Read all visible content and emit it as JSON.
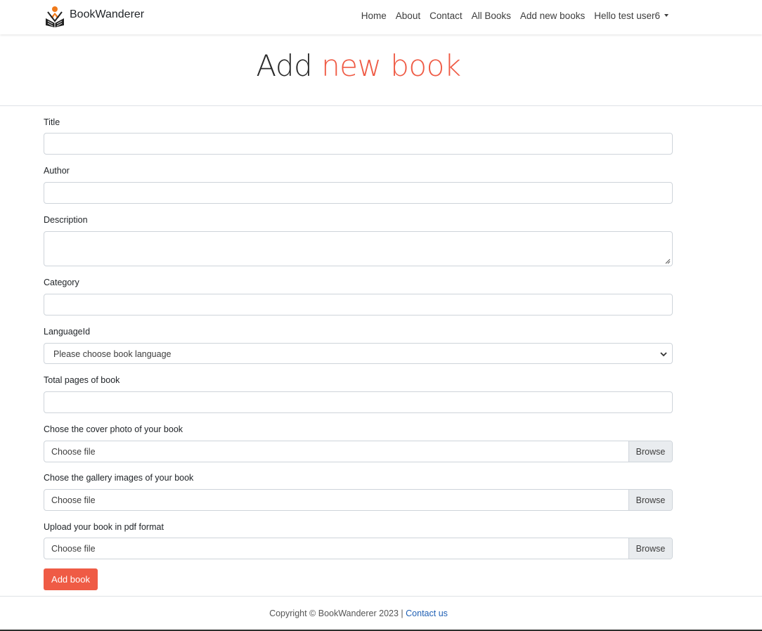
{
  "brand": {
    "name": "BookWanderer",
    "logo_icon": "book-reader-icon"
  },
  "nav": {
    "items": [
      "Home",
      "About",
      "Contact",
      "All Books",
      "Add new books"
    ],
    "user": "Hello test user6"
  },
  "hero": {
    "title_part1": "Add",
    "title_part2": "new book",
    "accent_color": "#ef5b45"
  },
  "form": {
    "title_label": "Title",
    "author_label": "Author",
    "description_label": "Description",
    "category_label": "Category",
    "language_label": "LanguageId",
    "language_selected": "Please choose book language",
    "pages_label": "Total pages of book",
    "cover_label": "Chose the cover photo of your book",
    "gallery_label": "Chose the gallery images of your book",
    "pdf_label": "Upload your book in pdf format",
    "file_placeholder": "Choose file",
    "browse_label": "Browse",
    "submit_label": "Add book"
  },
  "footer": {
    "copyright": "Copyright © BookWanderer 2023 |",
    "contact_link": "Contact us"
  }
}
